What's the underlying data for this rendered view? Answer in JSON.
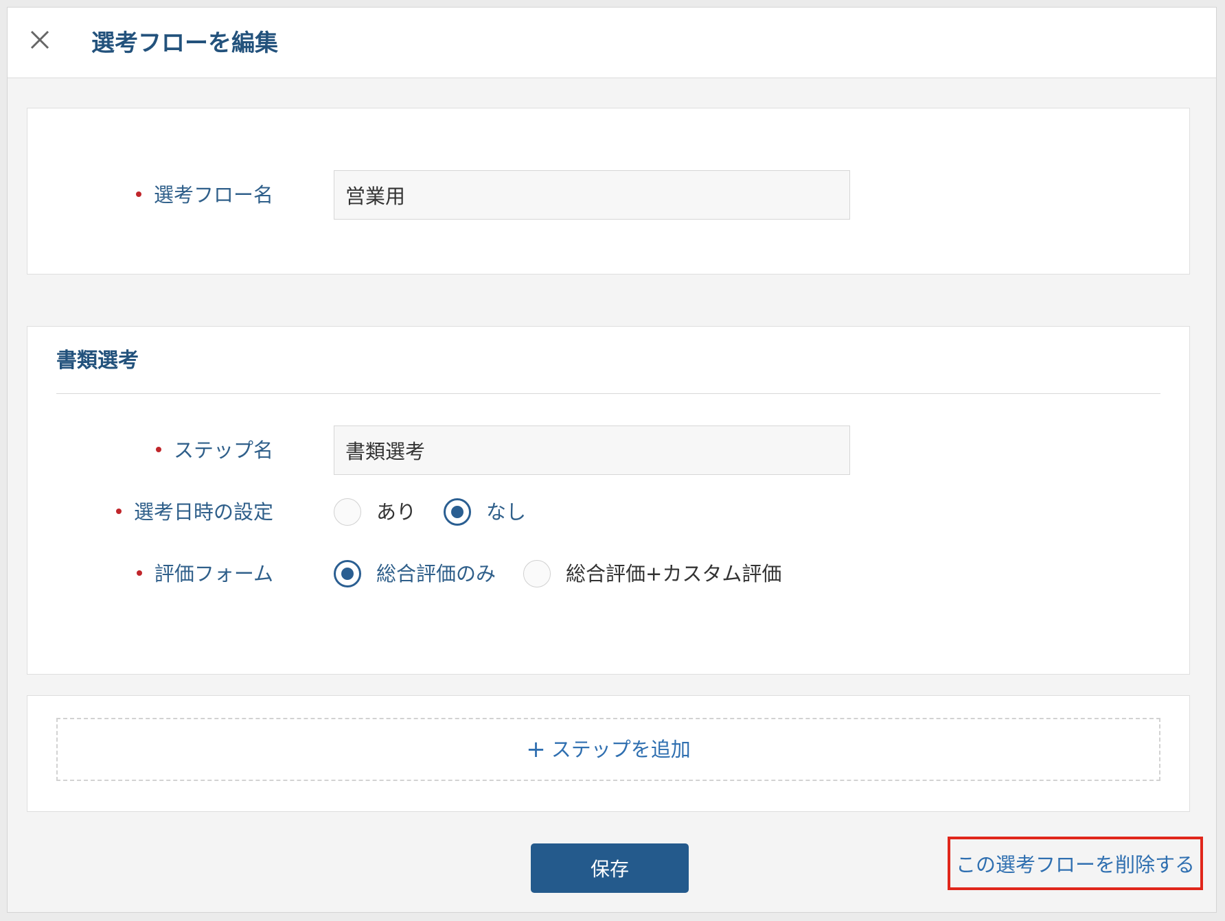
{
  "dialog": {
    "title": "選考フローを編集",
    "close_icon": "close-icon"
  },
  "flow_name": {
    "label": "選考フロー名",
    "value": "営業用",
    "required": true
  },
  "step": {
    "heading": "書類選考",
    "step_name": {
      "label": "ステップ名",
      "value": "書類選考",
      "required": true
    },
    "schedule": {
      "label": "選考日時の設定",
      "options": [
        "あり",
        "なし"
      ],
      "selected": "なし"
    },
    "form": {
      "label": "評価フォーム",
      "options": [
        "総合評価のみ",
        "総合評価+カスタム評価"
      ],
      "selected": "総合評価のみ"
    }
  },
  "add_step": {
    "icon": "plus-icon",
    "plus": "+",
    "label": "ステップを追加"
  },
  "footer": {
    "save_label": "保存",
    "delete_label": "この選考フローを削除する"
  },
  "colors": {
    "accent": "#245a8c",
    "link": "#2f6fb0",
    "required": "#c0262b",
    "highlight": "#e0261b"
  }
}
